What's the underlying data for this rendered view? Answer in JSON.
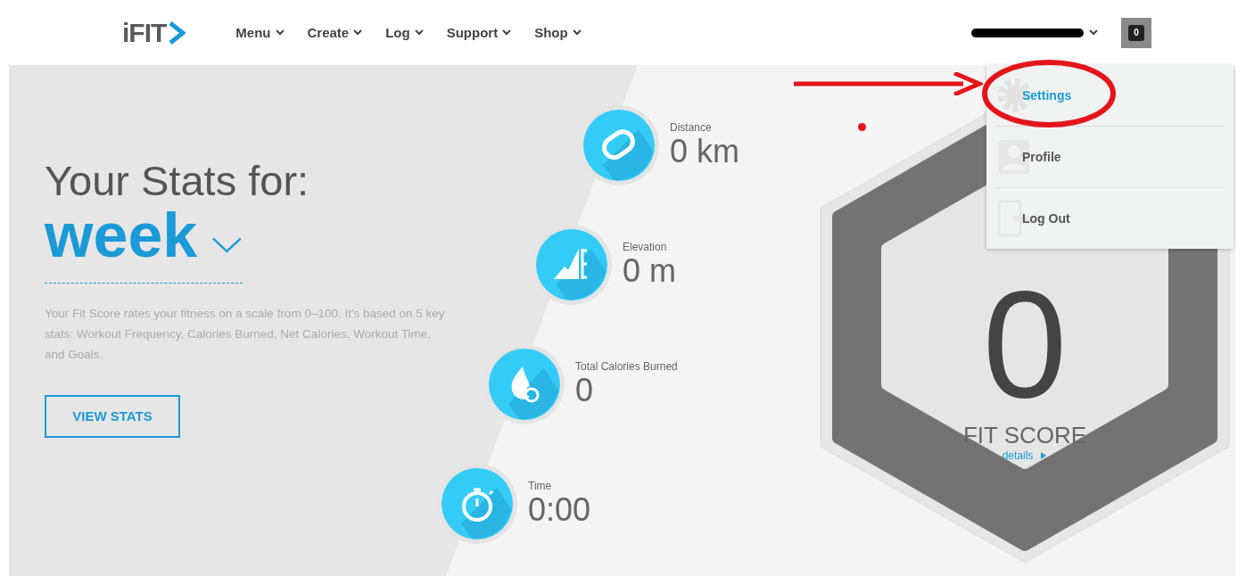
{
  "header": {
    "logo": "iFIT",
    "nav": [
      {
        "label": "Menu"
      },
      {
        "label": "Create"
      },
      {
        "label": "Log"
      },
      {
        "label": "Support"
      },
      {
        "label": "Shop"
      }
    ],
    "notification_count": "0"
  },
  "user_menu": {
    "items": [
      {
        "kind": "settings",
        "label": "Settings",
        "selected": true
      },
      {
        "kind": "profile",
        "label": "Profile",
        "selected": false
      },
      {
        "kind": "logout",
        "label": "Log Out",
        "selected": false
      }
    ]
  },
  "stats": {
    "heading": "Your Stats for:",
    "period": "week",
    "description": "Your Fit Score rates your fitness on a scale from 0–100. It's based on 5 key stats: Workout Frequency, Calories Burned, Net Calories, Workout Time, and Goals.",
    "button": "VIEW STATS",
    "items": [
      {
        "kind": "distance",
        "label": "Distance",
        "value": "0 km"
      },
      {
        "kind": "elevation",
        "label": "Elevation",
        "value": "0 m"
      },
      {
        "kind": "calories",
        "label": "Total Calories Burned",
        "value": "0"
      },
      {
        "kind": "time",
        "label": "Time",
        "value": "0:00"
      }
    ]
  },
  "fit_score": {
    "value": "0",
    "label": "FIT SCORE",
    "link": "details"
  }
}
